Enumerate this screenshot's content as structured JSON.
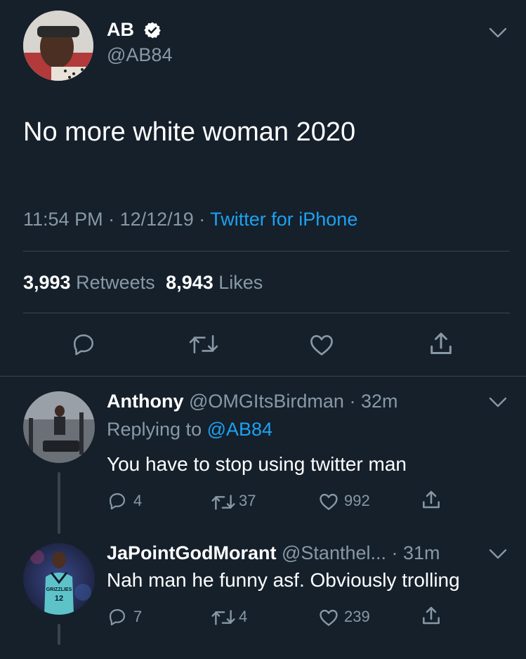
{
  "main_tweet": {
    "display_name": "AB",
    "handle": "@AB84",
    "text": "No more white woman 2020",
    "time": "11:54 PM",
    "date": "12/12/19",
    "source": "Twitter for iPhone",
    "retweets_count": "3,993",
    "retweets_label": "Retweets",
    "likes_count": "8,943",
    "likes_label": "Likes",
    "sep": "·"
  },
  "replies": [
    {
      "display_name": "Anthony",
      "handle": "@OMGItsBirdman",
      "time": "· 32m",
      "replying_label": "Replying to",
      "replying_to": "@AB84",
      "text": "You have to stop using twitter man",
      "reply_count": "4",
      "retweet_count": "37",
      "like_count": "992"
    },
    {
      "display_name": "JaPointGodMorant",
      "handle": "@Stanthel...",
      "time": "· 31m",
      "text": "Nah man he funny asf. Obviously trolling",
      "reply_count": "7",
      "retweet_count": "4",
      "like_count": "239",
      "jersey_text": "GRIZZLIES",
      "jersey_number": "12"
    }
  ],
  "colors": {
    "background": "#15202b",
    "accent": "#1da1f2",
    "secondary_text": "#8899a6",
    "divider": "#38444d"
  },
  "icons": [
    "verified-badge-icon",
    "chevron-down-icon",
    "reply-icon",
    "retweet-icon",
    "like-icon",
    "share-icon"
  ]
}
